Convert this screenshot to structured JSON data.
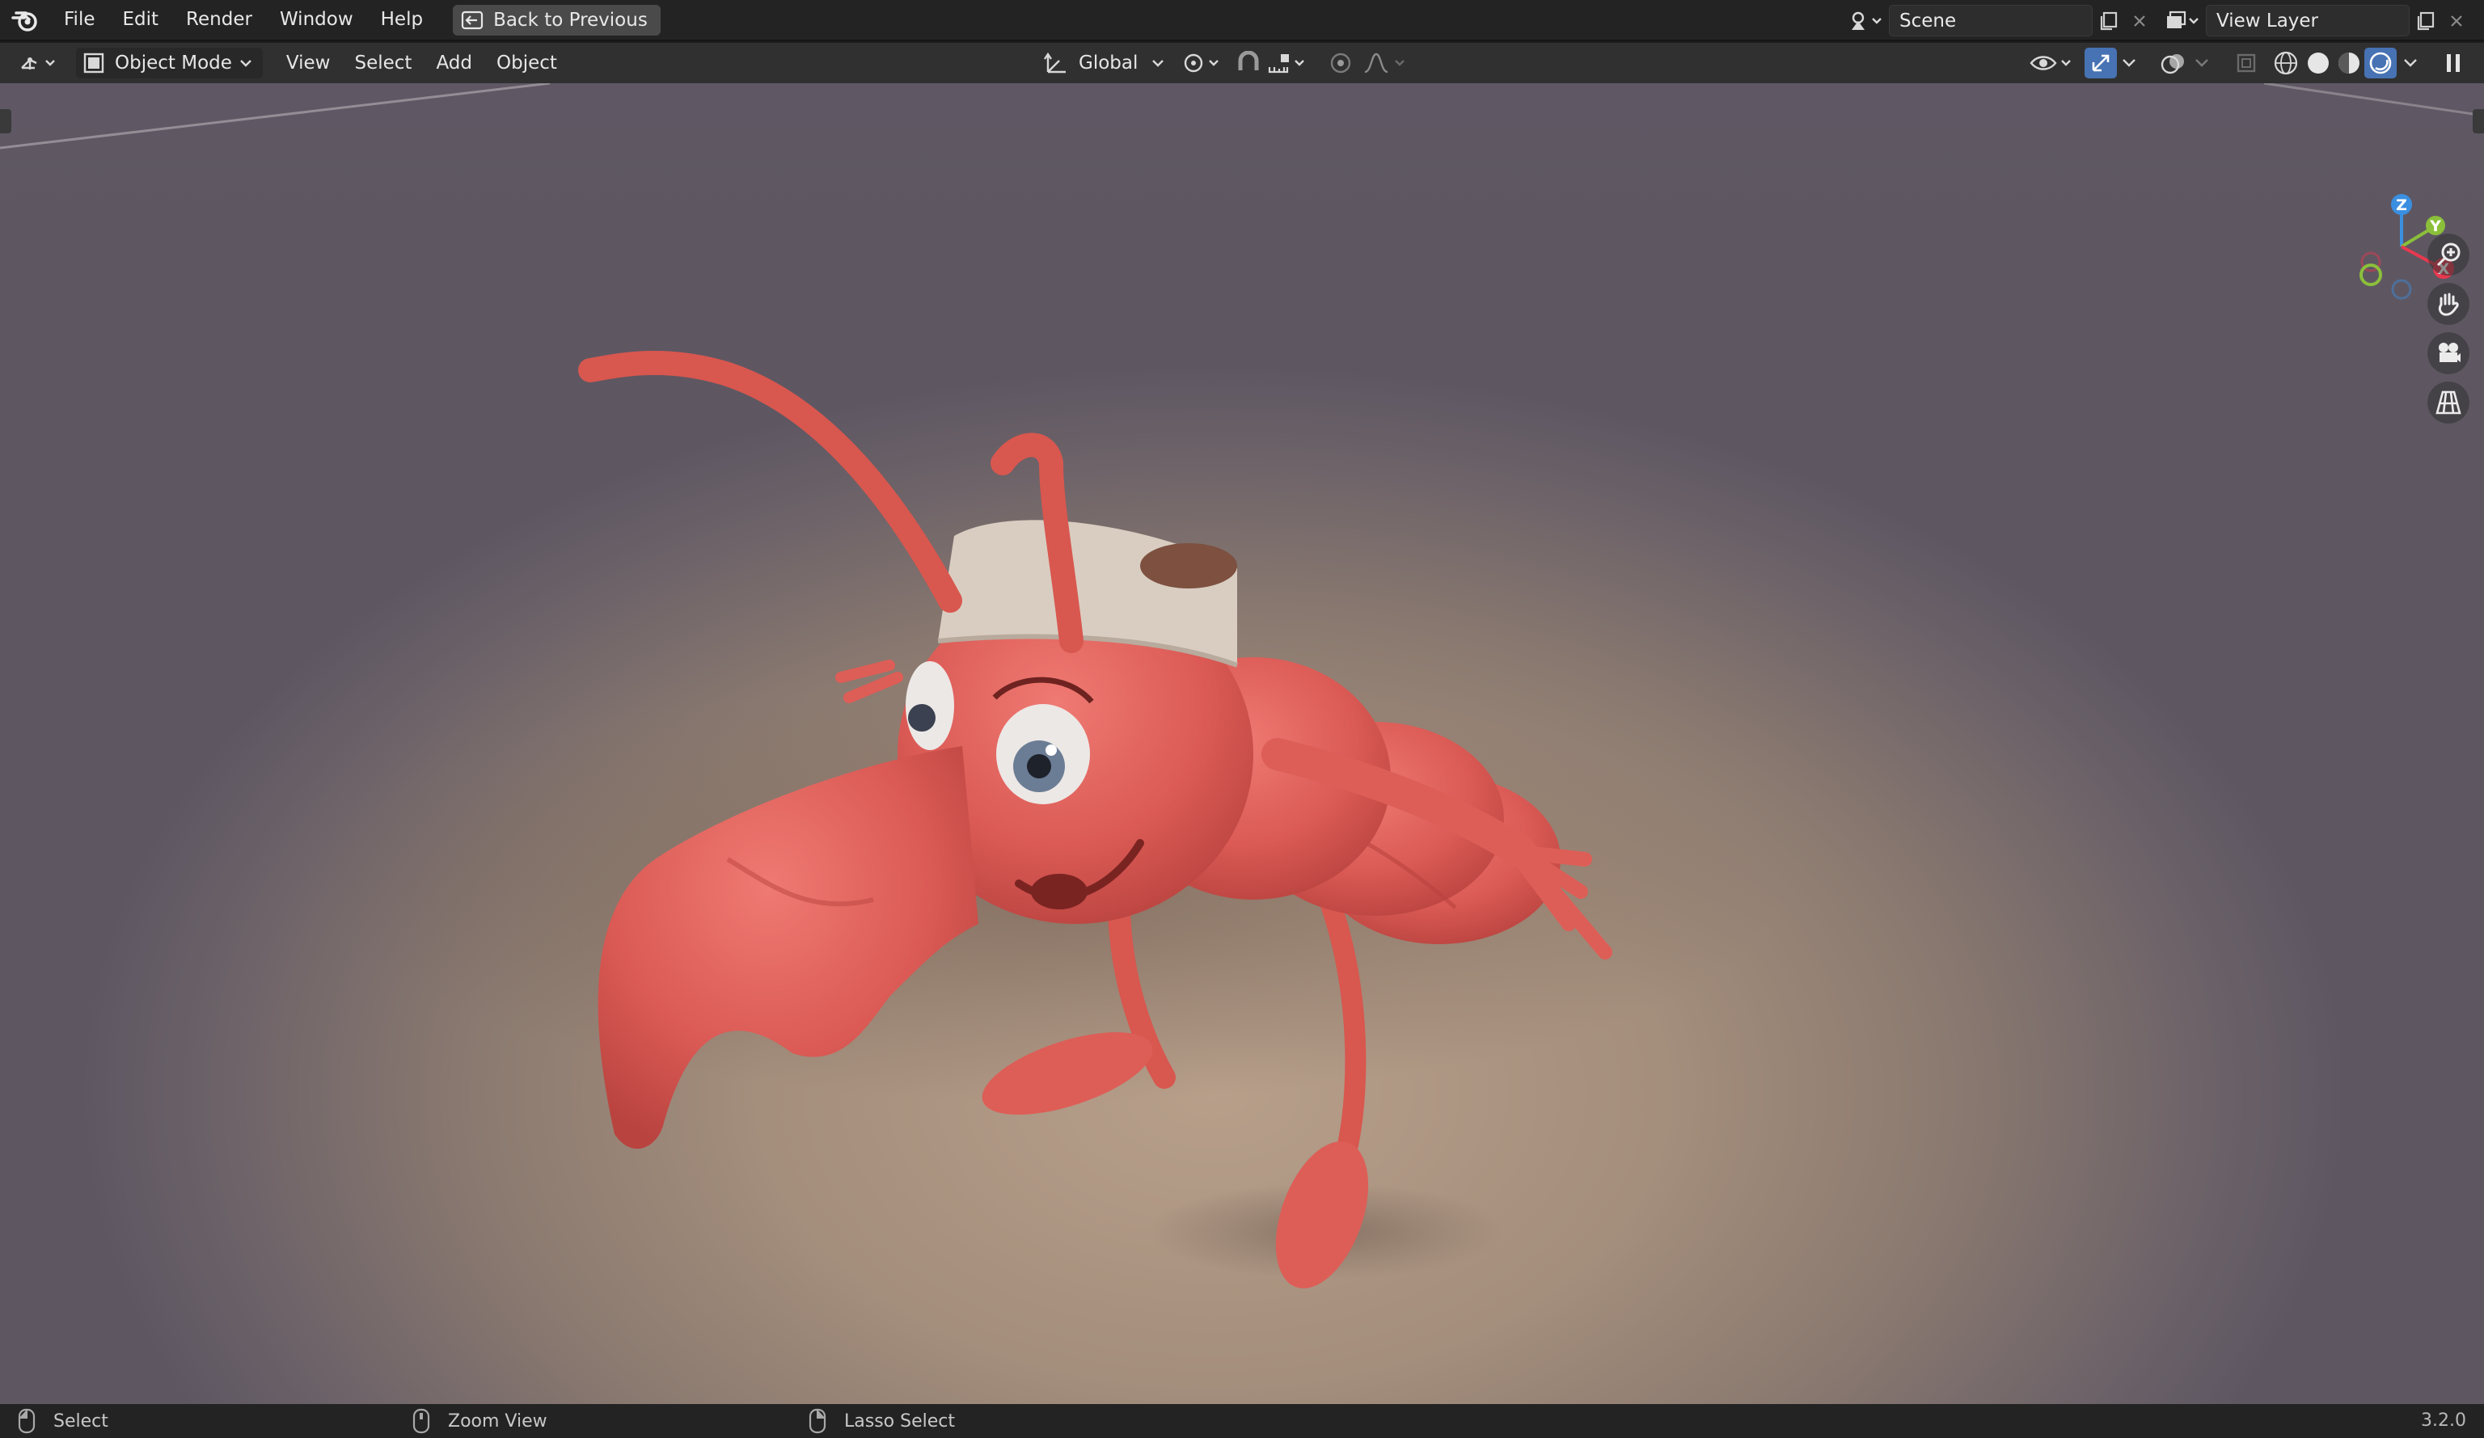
{
  "topbar": {
    "menus": [
      "File",
      "Edit",
      "Render",
      "Window",
      "Help"
    ],
    "back_button": "Back to Previous",
    "scene_name": "Scene",
    "view_layer_name": "View Layer"
  },
  "header": {
    "mode": "Object Mode",
    "menus": [
      "View",
      "Select",
      "Add",
      "Object"
    ],
    "transform_orientation": "Global"
  },
  "gizmo": {
    "z_label": "Z",
    "y_label": "Y",
    "x_label": "X",
    "colors": {
      "x": "#e8384f",
      "y": "#8bbf3a",
      "z": "#3b8fe0"
    }
  },
  "viewport_icons": [
    "zoom-in-icon",
    "hand-pan-icon",
    "camera-icon",
    "perspective-grid-icon"
  ],
  "statusbar": {
    "left": "Select",
    "middle": "Zoom View",
    "right": "Lasso Select",
    "version": "3.2.0"
  },
  "colors": {
    "accent": "#4772b3",
    "ant_red": "#e0625e"
  }
}
